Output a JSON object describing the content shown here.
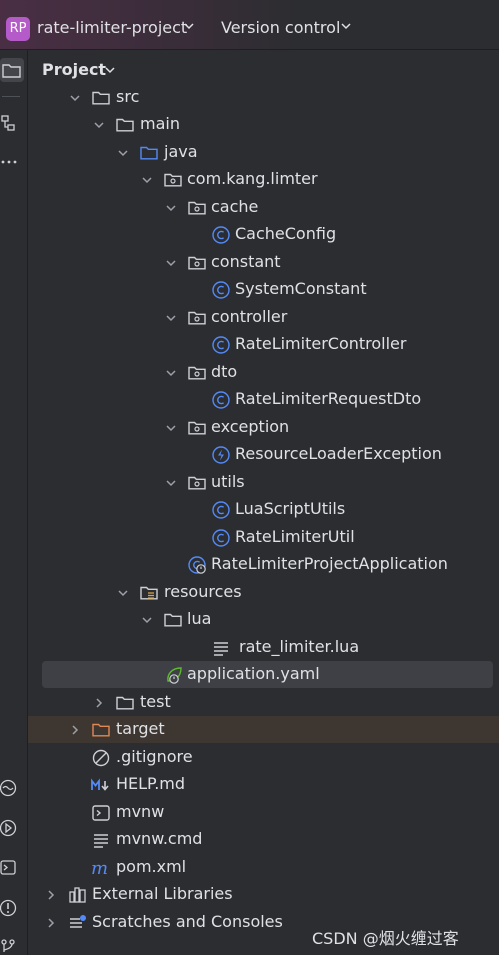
{
  "titlebar": {
    "project_badge": "RP",
    "project_name": "rate-limiter-project",
    "vcs_label": "Version control"
  },
  "panel": {
    "title": "Project"
  },
  "tree": {
    "src": "src",
    "main": "main",
    "java": "java",
    "package": "com.kang.limter",
    "cache": "cache",
    "cache_config": "CacheConfig",
    "constant": "constant",
    "system_constant": "SystemConstant",
    "controller": "controller",
    "rate_limiter_controller": "RateLimiterController",
    "dto": "dto",
    "rate_limiter_request_dto": "RateLimiterRequestDto",
    "exception": "exception",
    "resource_loader_exception": "ResourceLoaderException",
    "utils": "utils",
    "lua_script_utils": "LuaScriptUtils",
    "rate_limiter_util": "RateLimiterUtil",
    "application_class": "RateLimiterProjectApplication",
    "resources": "resources",
    "lua": "lua",
    "rate_limiter_lua": "rate_limiter.lua",
    "application_yaml": "application.yaml",
    "test": "test",
    "target": "target",
    "gitignore": ".gitignore",
    "help_md": "HELP.md",
    "mvnw": "mvnw",
    "mvnw_cmd": "mvnw.cmd",
    "pom_xml": "pom.xml",
    "external_libraries": "External Libraries",
    "scratches": "Scratches and Consoles"
  },
  "watermark": "CSDN @烟火缠过客",
  "colors": {
    "background": "#2b2d30",
    "class_icon": "#548af7",
    "exception_icon": "#548af7",
    "spring_icon": "#5fb832",
    "excluded_folder": "#e08855",
    "selection": "#3e4046"
  }
}
